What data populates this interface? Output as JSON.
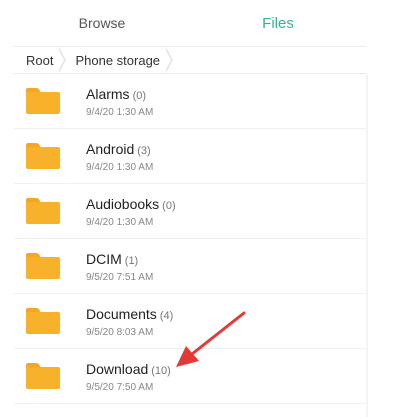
{
  "tabs": [
    {
      "label": "Browse",
      "active": false
    },
    {
      "label": "Files",
      "active": true
    }
  ],
  "accent_color": "#2eb58f",
  "folder_color": "#f7b12b",
  "annotation_color": "#e53935",
  "breadcrumb": [
    "Root",
    "Phone storage"
  ],
  "folders": [
    {
      "name": "Alarms",
      "count": "(0)",
      "date": "9/4/20 1:30 AM"
    },
    {
      "name": "Android",
      "count": "(3)",
      "date": "9/4/20 1:30 AM"
    },
    {
      "name": "Audiobooks",
      "count": "(0)",
      "date": "9/4/20 1:30 AM"
    },
    {
      "name": "DCIM",
      "count": "(1)",
      "date": "9/5/20 7:51 AM"
    },
    {
      "name": "Documents",
      "count": "(4)",
      "date": "9/5/20 8:03 AM"
    },
    {
      "name": "Download",
      "count": "(10)",
      "date": "9/5/20 7:50 AM"
    }
  ],
  "icons": {
    "folder": "folder-icon",
    "annotation": "red-arrow-annotation"
  }
}
